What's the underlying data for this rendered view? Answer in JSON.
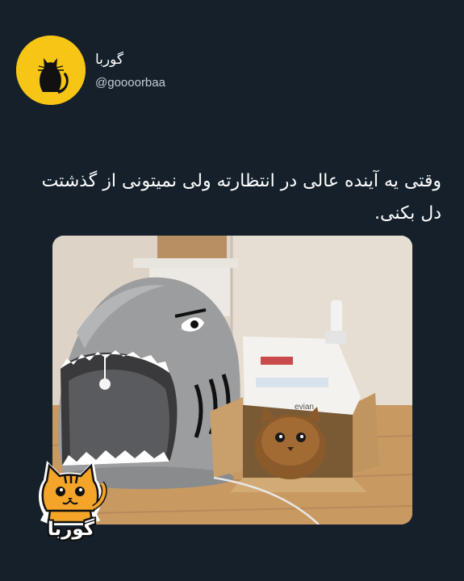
{
  "account": {
    "display_name": "گوربا",
    "handle": "@goooorbaa",
    "avatar_icon": "black-cat-icon",
    "avatar_color": "#f6c516"
  },
  "tweet": {
    "text": "وقتی یه آینده عالی در انتظارته ولی نمیتونی از گذشتت دل بکنی."
  },
  "photo": {
    "box_brand": "evian"
  },
  "watermark": {
    "label": "گوربا",
    "icon": "orange-cat-sticker-icon"
  },
  "colors": {
    "background": "#15202b",
    "text": "#ffffff",
    "handle": "#c5ccd3",
    "accent": "#f6c516"
  }
}
